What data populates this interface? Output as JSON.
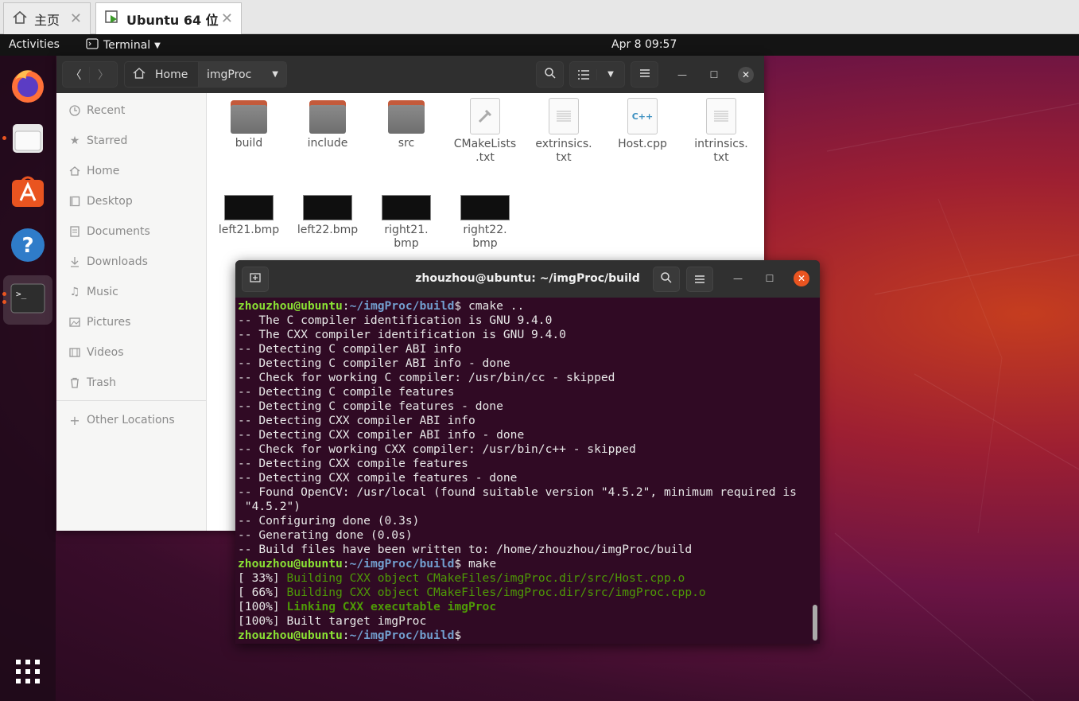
{
  "vm_tabs": [
    {
      "label": "主页",
      "icon": "home-icon"
    },
    {
      "label": "Ubuntu 64 位",
      "icon": "vm-play-icon"
    }
  ],
  "topbar": {
    "activities": "Activities",
    "app": "Terminal",
    "clock": "Apr 8  09:57"
  },
  "dock": [
    "firefox-icon",
    "files-icon",
    "software-icon",
    "help-icon",
    "terminal-icon",
    "apps-grid-icon"
  ],
  "files": {
    "path": {
      "home": "Home",
      "current": "imgProc"
    },
    "sidebar": [
      {
        "label": "Recent",
        "icon": "clock-icon"
      },
      {
        "label": "Starred",
        "icon": "star-icon"
      },
      {
        "label": "Home",
        "icon": "home-icon"
      },
      {
        "label": "Desktop",
        "icon": "desktop-icon"
      },
      {
        "label": "Documents",
        "icon": "document-icon"
      },
      {
        "label": "Downloads",
        "icon": "download-icon"
      },
      {
        "label": "Music",
        "icon": "music-icon"
      },
      {
        "label": "Pictures",
        "icon": "picture-icon"
      },
      {
        "label": "Videos",
        "icon": "video-icon"
      },
      {
        "label": "Trash",
        "icon": "trash-icon"
      },
      {
        "label": "Other Locations",
        "icon": "plus-icon"
      }
    ],
    "items": [
      {
        "name": "build",
        "kind": "folder"
      },
      {
        "name": "include",
        "kind": "folder"
      },
      {
        "name": "src",
        "kind": "folder"
      },
      {
        "name": "CMakeLists\n.txt",
        "kind": "cmake"
      },
      {
        "name": "extrinsics.\ntxt",
        "kind": "text"
      },
      {
        "name": "Host.cpp",
        "kind": "cpp"
      },
      {
        "name": "intrinsics.\ntxt",
        "kind": "text"
      },
      {
        "name": "left21.bmp",
        "kind": "image"
      },
      {
        "name": "left22.bmp",
        "kind": "image"
      },
      {
        "name": "right21.\nbmp",
        "kind": "image"
      },
      {
        "name": "right22.\nbmp",
        "kind": "image"
      }
    ]
  },
  "terminal": {
    "title": "zhouzhou@ubuntu: ~/imgProc/build",
    "prompt_user": "zhouzhou@ubuntu",
    "prompt_path": "~/imgProc/build",
    "lines": [
      {
        "type": "prompt",
        "cmd": " cmake .."
      },
      {
        "type": "out",
        "text": "-- The C compiler identification is GNU 9.4.0"
      },
      {
        "type": "out",
        "text": "-- The CXX compiler identification is GNU 9.4.0"
      },
      {
        "type": "out",
        "text": "-- Detecting C compiler ABI info"
      },
      {
        "type": "out",
        "text": "-- Detecting C compiler ABI info - done"
      },
      {
        "type": "out",
        "text": "-- Check for working C compiler: /usr/bin/cc - skipped"
      },
      {
        "type": "out",
        "text": "-- Detecting C compile features"
      },
      {
        "type": "out",
        "text": "-- Detecting C compile features - done"
      },
      {
        "type": "out",
        "text": "-- Detecting CXX compiler ABI info"
      },
      {
        "type": "out",
        "text": "-- Detecting CXX compiler ABI info - done"
      },
      {
        "type": "out",
        "text": "-- Check for working CXX compiler: /usr/bin/c++ - skipped"
      },
      {
        "type": "out",
        "text": "-- Detecting CXX compile features"
      },
      {
        "type": "out",
        "text": "-- Detecting CXX compile features - done"
      },
      {
        "type": "out",
        "text": "-- Found OpenCV: /usr/local (found suitable version \"4.5.2\", minimum required is"
      },
      {
        "type": "out",
        "text": " \"4.5.2\")"
      },
      {
        "type": "out",
        "text": "-- Configuring done (0.3s)"
      },
      {
        "type": "out",
        "text": "-- Generating done (0.0s)"
      },
      {
        "type": "out",
        "text": "-- Build files have been written to: /home/zhouzhou/imgProc/build"
      },
      {
        "type": "prompt",
        "cmd": " make"
      },
      {
        "type": "build",
        "pct": "[ 33%] ",
        "text": "Building CXX object CMakeFiles/imgProc.dir/src/Host.cpp.o"
      },
      {
        "type": "build",
        "pct": "[ 66%] ",
        "text": "Building CXX object CMakeFiles/imgProc.dir/src/imgProc.cpp.o"
      },
      {
        "type": "link",
        "pct": "[100%] ",
        "text": "Linking CXX executable imgProc"
      },
      {
        "type": "out",
        "text": "[100%] Built target imgProc"
      },
      {
        "type": "prompt",
        "cmd": ""
      }
    ]
  }
}
